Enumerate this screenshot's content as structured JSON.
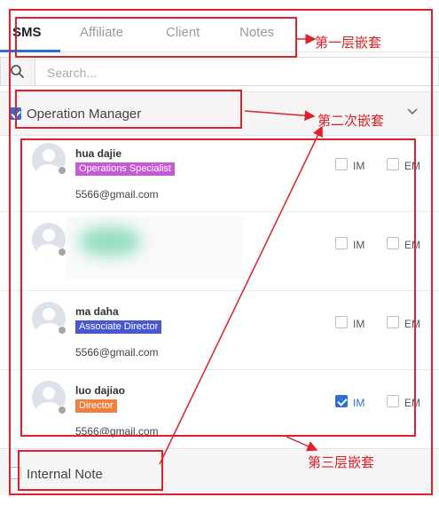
{
  "tabs": [
    {
      "label": "SMS",
      "active": true
    },
    {
      "label": "Affiliate",
      "active": false
    },
    {
      "label": "Client",
      "active": false
    },
    {
      "label": "Notes",
      "active": false
    }
  ],
  "search": {
    "placeholder": "Search...",
    "value": ""
  },
  "group": {
    "label": "Operation Manager",
    "checked": true
  },
  "members": [
    {
      "name": "hua dajie",
      "role": "Operations Specialist",
      "role_color": "#c659d6",
      "email": "5566@gmail.com",
      "im": false,
      "em": false
    },
    {
      "name": "",
      "role": "",
      "email": "",
      "im": false,
      "em": false,
      "obscured": true
    },
    {
      "name": "ma daha",
      "role": "Associate Director",
      "role_color": "#4a57d3",
      "email": "5566@gmail.com",
      "im": false,
      "em": false
    },
    {
      "name": "luo dajiao",
      "role": "Director",
      "role_color": "#f07e3f",
      "email": "5566@gmail.com",
      "im": true,
      "em": false
    }
  ],
  "option_labels": {
    "im": "IM",
    "em": "EM"
  },
  "footer": {
    "label": "Internal Note",
    "checked": false
  },
  "annotations": {
    "layer1": "第一层嵌套",
    "layer2": "第二次嵌套",
    "layer3": "第三层嵌套"
  },
  "colors": {
    "accent": "#2f6fdc",
    "annotation": "#e0202a"
  }
}
